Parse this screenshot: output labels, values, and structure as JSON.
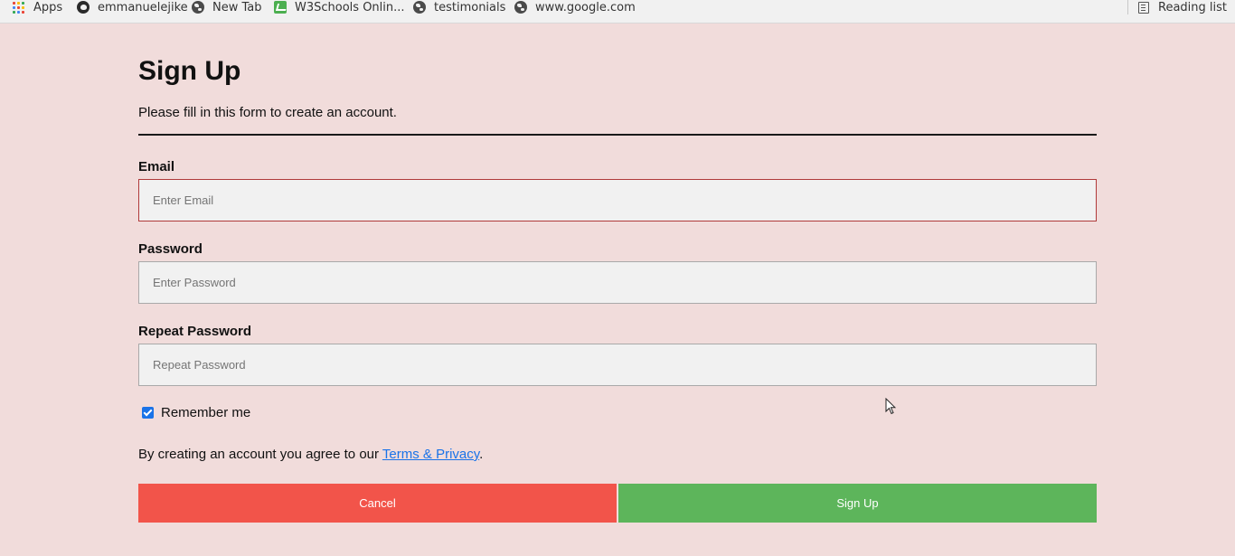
{
  "bookmarks": {
    "items": [
      {
        "label": "Apps",
        "icon": "apps-grid-icon"
      },
      {
        "label": "emmanuelejike",
        "icon": "github-icon"
      },
      {
        "label": "New Tab",
        "icon": "globe-icon"
      },
      {
        "label": "W3Schools Onlin...",
        "icon": "w3schools-icon"
      },
      {
        "label": "testimonials",
        "icon": "globe-icon"
      },
      {
        "label": "www.google.com",
        "icon": "globe-icon"
      }
    ],
    "reading_list": "Reading list"
  },
  "form": {
    "title": "Sign Up",
    "subtitle": "Please fill in this form to create an account.",
    "email_label": "Email",
    "email_placeholder": "Enter Email",
    "email_value": "",
    "password_label": "Password",
    "password_placeholder": "Enter Password",
    "password_value": "",
    "repeat_label": "Repeat Password",
    "repeat_placeholder": "Repeat Password",
    "repeat_value": "",
    "remember_label": "Remember me",
    "remember_checked": true,
    "terms_prefix": "By creating an account you agree to our ",
    "terms_link": "Terms & Privacy",
    "terms_suffix": ".",
    "cancel_label": "Cancel",
    "signup_label": "Sign Up"
  },
  "colors": {
    "page_background": "#f1dcdb",
    "cancel_button": "#f2544a",
    "signup_button": "#5db55b",
    "link": "#1a73e8",
    "focus_border": "#b03a3a"
  }
}
